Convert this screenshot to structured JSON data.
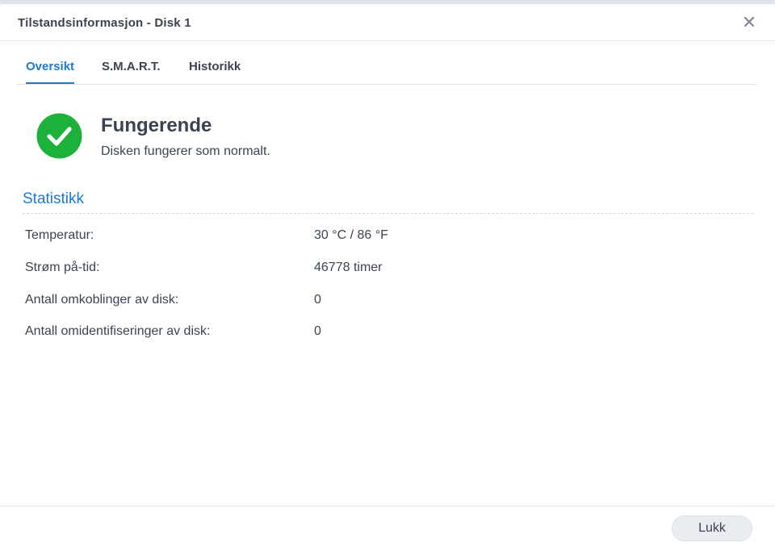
{
  "background": {
    "left_text": "",
    "right_text": ""
  },
  "dialog": {
    "title": "Tilstandsinformasjon - Disk 1",
    "close_icon": "close-icon"
  },
  "tabs": [
    {
      "label": "Oversikt",
      "active": true
    },
    {
      "label": "S.M.A.R.T.",
      "active": false
    },
    {
      "label": "Historikk",
      "active": false
    }
  ],
  "status": {
    "icon": "check-circle-icon",
    "title": "Fungerende",
    "description": "Disken fungerer som normalt."
  },
  "statistics": {
    "title": "Statistikk",
    "rows": [
      {
        "label": "Temperatur:",
        "value": "30 °C / 86 °F"
      },
      {
        "label": "Strøm på-tid:",
        "value": "46778 timer"
      },
      {
        "label": "Antall omkoblinger av disk:",
        "value": "0"
      },
      {
        "label": "Antall omidentifiseringer av disk:",
        "value": "0"
      }
    ]
  },
  "footer": {
    "close_label": "Lukk"
  },
  "colors": {
    "accent": "#1b7ad4",
    "success": "#1bb13a",
    "text": "#3c4350"
  }
}
